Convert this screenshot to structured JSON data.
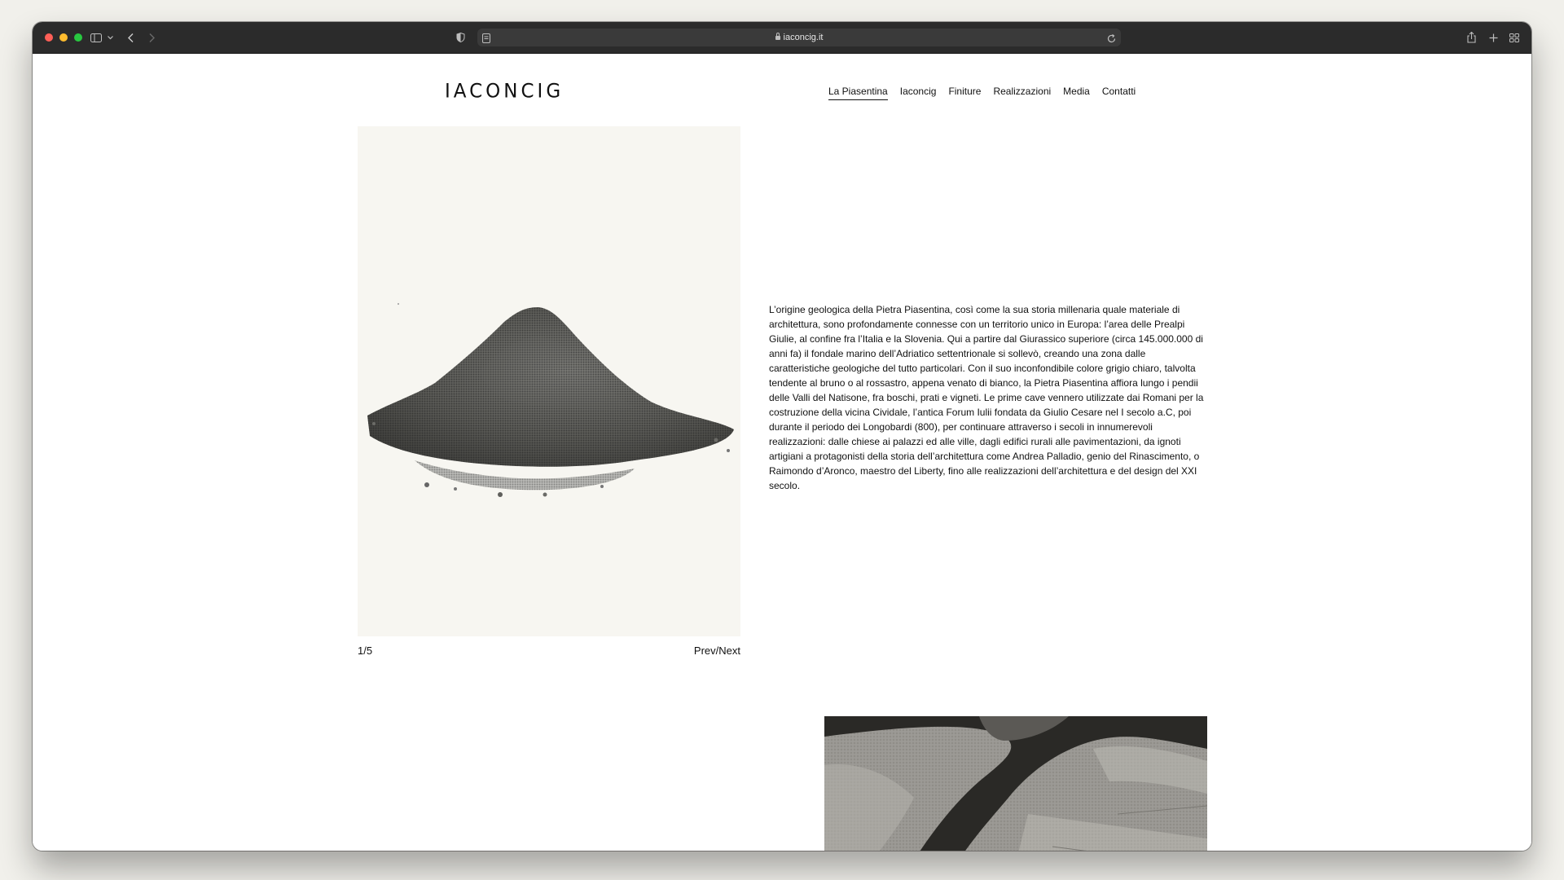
{
  "browser": {
    "url": "iaconcig.it",
    "icons": [
      "sidebar-icon",
      "chevron-down-icon",
      "back-icon",
      "forward-icon",
      "privacy-shield-icon",
      "reader-icon",
      "lock-icon",
      "reload-icon",
      "share-icon",
      "new-tab-icon",
      "tab-overview-icon"
    ]
  },
  "header": {
    "logo": "IACONCIG",
    "nav": [
      {
        "label": "La Piasentina",
        "active": true
      },
      {
        "label": "Iaconcig"
      },
      {
        "label": "Finiture"
      },
      {
        "label": "Realizzazioni"
      },
      {
        "label": "Media"
      },
      {
        "label": "Contatti"
      }
    ]
  },
  "gallery": {
    "counter": "1/5",
    "prev_label": "Prev",
    "separator": "/",
    "next_label": "Next"
  },
  "main": {
    "text": "L’origine geologica della Pietra Piasentina, così come la sua storia millenaria quale materiale di architettura, sono profondamente connesse con un territorio unico in Europa: l’area delle Prealpi Giulie, al confine fra l’Italia e la Slovenia. Qui a partire dal Giurassico superiore (circa 145.000.000 di anni fa) il fondale marino dell’Adriatico settentrionale si sollevò, creando una zona dalle caratteristiche geologiche del tutto particolari. Con il suo inconfondibile colore grigio chiaro, talvolta tendente al bruno o al rossastro, appena venato di bianco, la Pietra Piasentina affiora lungo i pendii delle Valli del Natisone, fra boschi, prati e vigneti. Le prime cave vennero utilizzate dai Romani per la costruzione della vicina Cividale, l’antica Forum Iulii fondata da Giulio Cesare nel I secolo a.C, poi durante il periodo dei Longobardi (800), per continuare attraverso i secoli in innumerevoli realizzazioni: dalle chiese ai palazzi ed alle ville, dagli edifici rurali alle pavimentazioni, da ignoti artigiani a protagonisti della storia dell’architettura come Andrea Palladio, genio del Rinascimento, o Raimondo d’Aronco, maestro del Liberty, fino alle realizzazioni dell’architettura e del design del XXI secolo."
  },
  "colors": {
    "chrome": "#2b2b2b",
    "page_bg": "#ffffff",
    "image_bg": "#f7f6f1",
    "text": "#111111"
  }
}
